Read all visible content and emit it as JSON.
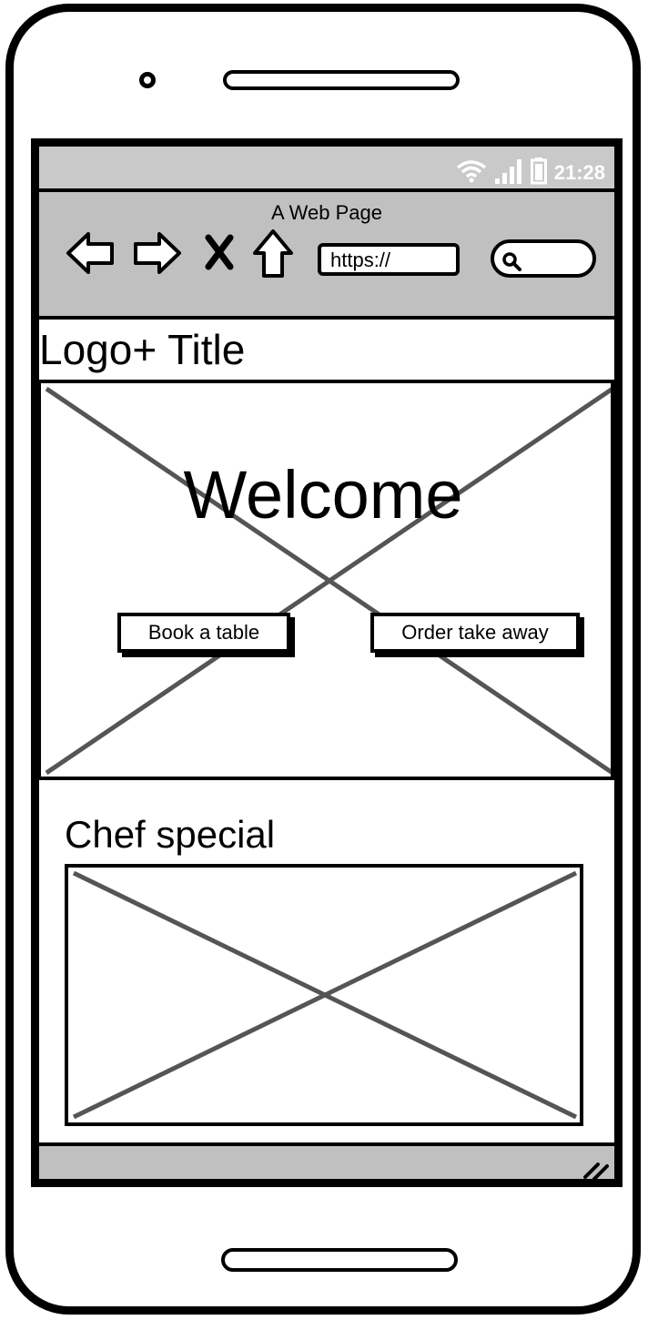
{
  "status_bar": {
    "time": "21:28",
    "icons": [
      "wifi-icon",
      "signal-icon",
      "battery-icon"
    ]
  },
  "browser": {
    "title": "A Web Page",
    "url": "https://",
    "nav_icons": [
      "back-arrow-icon",
      "forward-arrow-icon",
      "stop-x-icon",
      "home-icon"
    ],
    "search_icon": "search-icon"
  },
  "header": {
    "logo_title": "Logo+ Title"
  },
  "hero": {
    "heading": "Welcome",
    "buttons": {
      "book": "Book a table",
      "order": "Order take away"
    }
  },
  "chef_special": {
    "title": "Chef special"
  },
  "colors": {
    "chrome_gray": "#c0c0c0",
    "status_gray": "#c9c9c9",
    "placeholder_line": "#555555"
  }
}
